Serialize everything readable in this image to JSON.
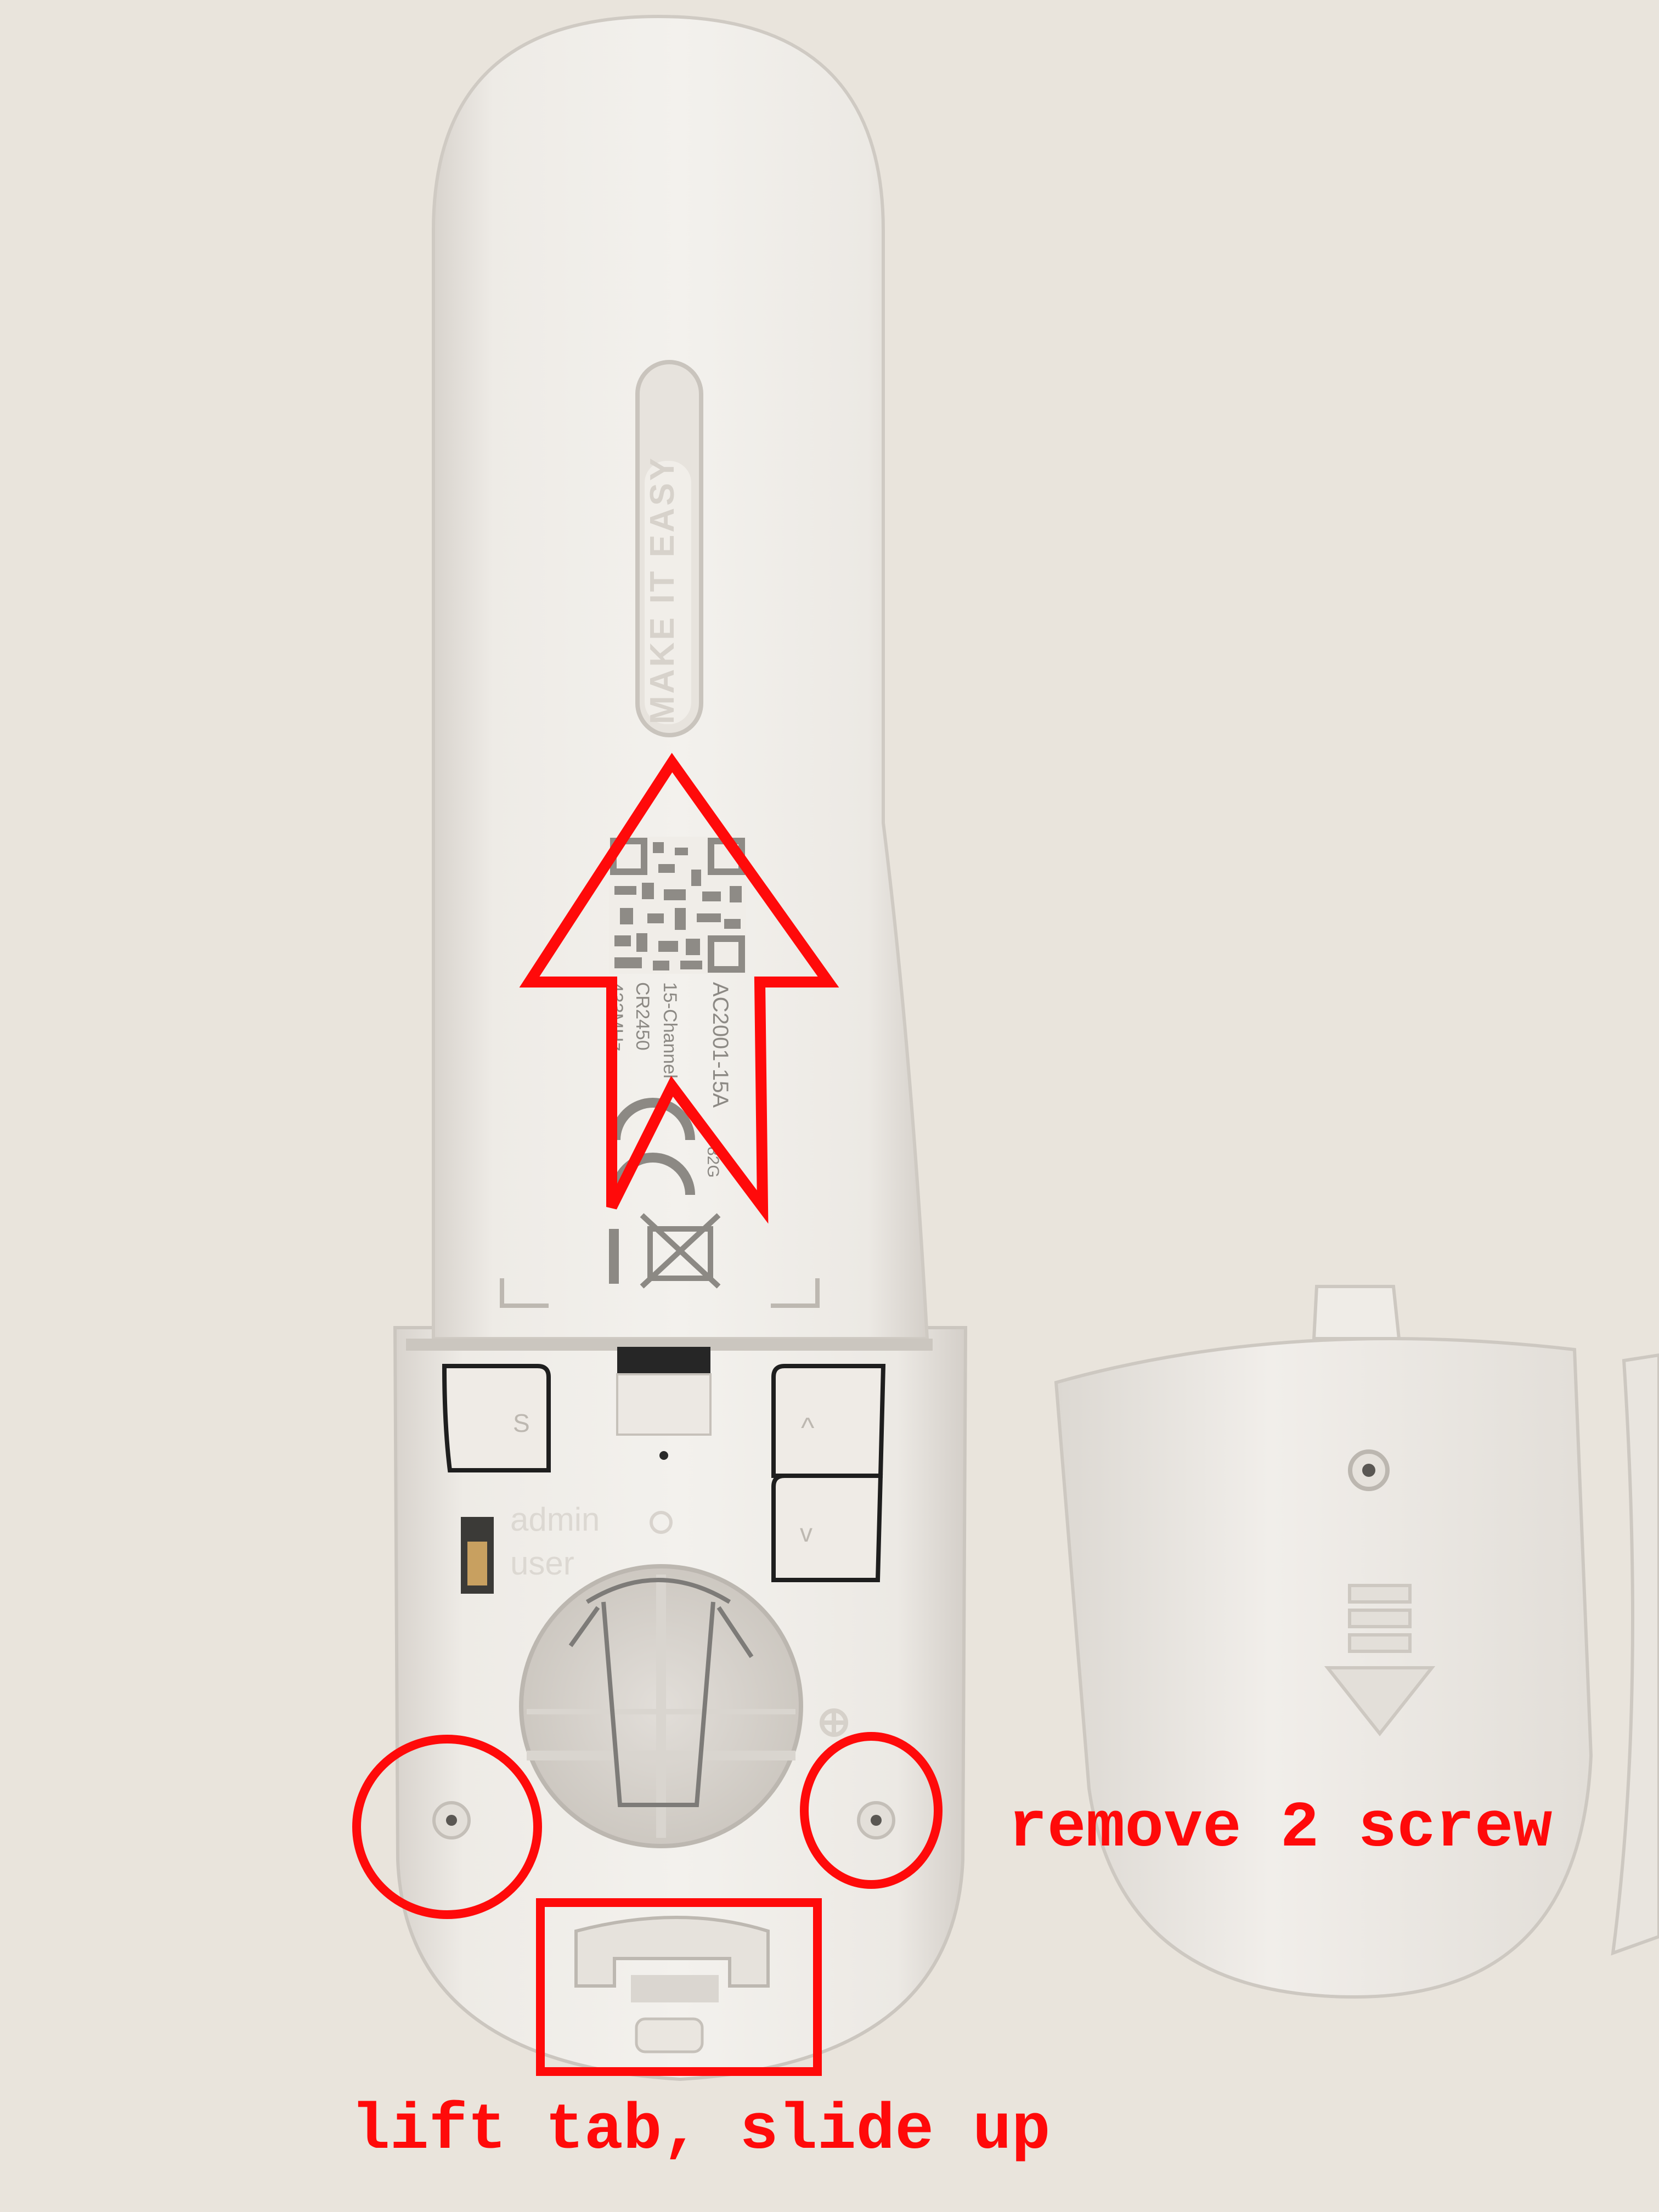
{
  "photo": {
    "subject": "remote control with battery cover removed",
    "colors": {
      "background": "#ebe6de",
      "plastic": "#f1eeea",
      "plastic_shadow": "#d9d4ce",
      "annotation": "#ff0a0a",
      "label_text": "#8c8984"
    }
  },
  "slider_text": "MAKE IT EASY",
  "product_label": {
    "model": "AC2001-15A",
    "channels": "15-Channel",
    "battery": "CR2450",
    "frequency": "433MHz",
    "code": "82G"
  },
  "buttons": {
    "stop": "S",
    "up": "^",
    "down": "v"
  },
  "switch_labels": {
    "admin": "admin",
    "user": "user"
  },
  "annotations": {
    "screws": "remove 2 screw",
    "tab": "lift tab, slide up"
  }
}
